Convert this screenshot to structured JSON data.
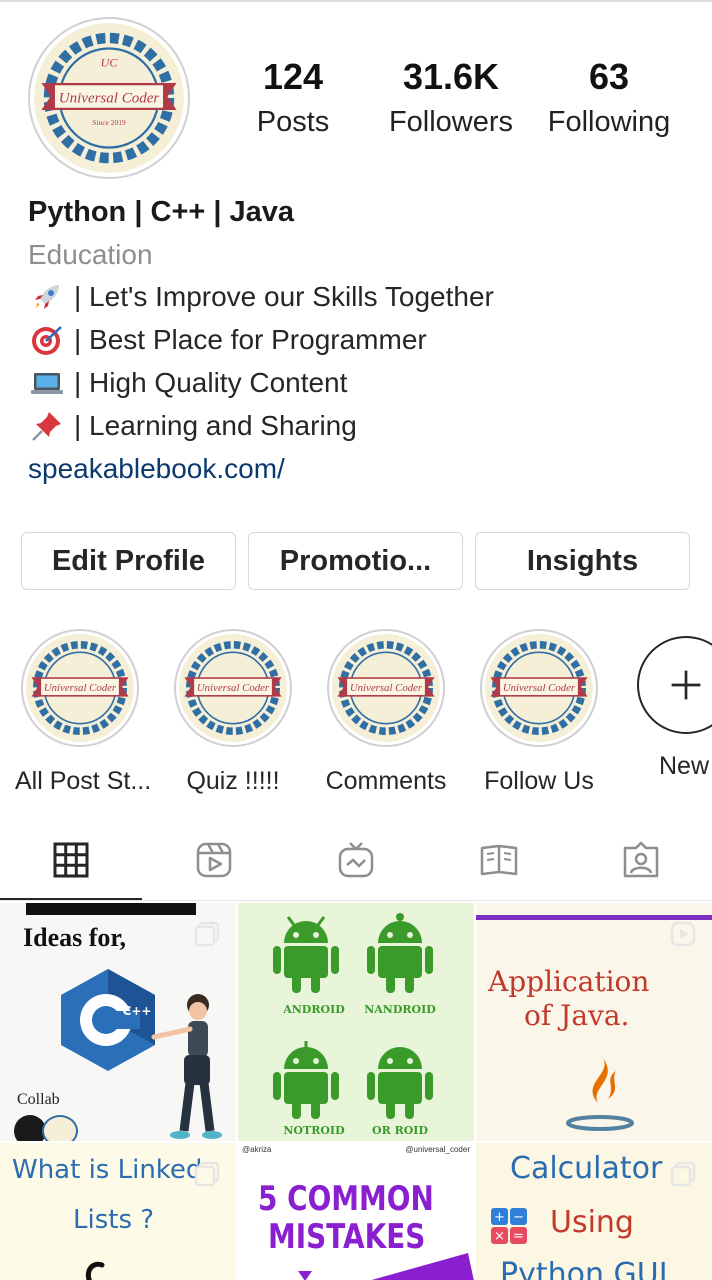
{
  "profile": {
    "logo_text": "Universal Coder",
    "logo_sub": "Since 2019",
    "logo_mark": "UC",
    "stats": [
      {
        "value": "124",
        "label": "Posts"
      },
      {
        "value": "31.6K",
        "label": "Followers"
      },
      {
        "value": "63",
        "label": "Following"
      }
    ],
    "name": "Python | C++ | Java",
    "category": "Education",
    "bio_lines": [
      {
        "icon": "rocket-icon",
        "text": "| Let's Improve our Skills Together"
      },
      {
        "icon": "target-icon",
        "text": "| Best Place for Programmer"
      },
      {
        "icon": "laptop-icon",
        "text": "| High Quality Content"
      },
      {
        "icon": "pushpin-icon",
        "text": "| Learning and Sharing"
      }
    ],
    "link": "speakablebook.com/"
  },
  "actions": {
    "edit_profile": "Edit Profile",
    "promotions": "Promotio...",
    "insights": "Insights"
  },
  "highlights": [
    {
      "label": "All Post St..."
    },
    {
      "label": "Quiz !!!!!"
    },
    {
      "label": "Comments"
    },
    {
      "label": "Follow Us"
    }
  ],
  "new_highlight": {
    "label": "New",
    "icon": "plus-icon"
  },
  "tabs": [
    "grid-icon",
    "reels-icon",
    "igtv-icon",
    "guides-icon",
    "tagged-icon"
  ],
  "posts": {
    "p1": {
      "title": "Ideas for,",
      "lang": "C++",
      "footer": "Collab",
      "corner_icon": "multiple-posts-icon"
    },
    "p2": {
      "labels": [
        "ANDROID",
        "NANDROID",
        "NOTROID",
        "OR ROID"
      ]
    },
    "p3": {
      "line1": "Application",
      "line2": "of Java.",
      "corner_icon": "reel-icon"
    },
    "p4": {
      "line1": "What is Linked",
      "line2": "Lists ?",
      "corner_icon": "multiple-posts-icon"
    },
    "p5": {
      "handle_left": "@akriza",
      "handle_right": "@universal_coder",
      "line1": "5 COMMON",
      "line2": "MISTAKES"
    },
    "p6": {
      "line1": "Calculator",
      "line2": "Using",
      "line3": "Python GUI",
      "corner_icon": "multiple-posts-icon"
    }
  },
  "colors": {
    "link": "#0b3a6e",
    "muted": "#8e8e8e",
    "logo_ribbon": "#b03a48",
    "logo_ring": "#2f6fa3",
    "android_green": "#3a9a2a",
    "post_purple": "#8a1fd0"
  }
}
